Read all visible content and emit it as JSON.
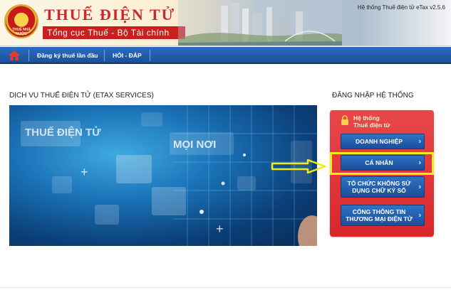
{
  "header": {
    "emblem_text": "THUẾ NHÀ NƯỚC",
    "title": "THUẾ ĐIỆN TỬ",
    "subtitle": "Tổng cục Thuế - Bộ Tài chính",
    "system_version": "Hệ thống Thuế điện tử eTax v2.5.6"
  },
  "nav": {
    "home_icon": "home-icon",
    "items": [
      {
        "label": "Đăng ký thuế lần đầu"
      },
      {
        "label": "HỎI - ĐÁP"
      }
    ]
  },
  "main": {
    "section_title": "DỊCH VỤ THUẾ ĐIỆN TỬ (ETAX SERVICES)",
    "banner_text_1": "THUẾ ĐIỆN TỬ",
    "banner_text_2": "MỌI NƠI"
  },
  "login": {
    "section_title": "ĐĂNG NHẬP HỆ THỐNG",
    "panel_label_line1": "Hệ thống",
    "panel_label_line2": "Thuế điện tử",
    "buttons": [
      {
        "label": "DOANH NGHIỆP"
      },
      {
        "label": "CÁ NHÂN"
      },
      {
        "label_line1": "TỔ CHỨC KHÔNG SỬ",
        "label_line2": "DỤNG CHỮ KÝ SỐ"
      },
      {
        "label_line1": "CỔNG THÔNG TIN",
        "label_line2": "THƯƠNG MẠI ĐIỆN TỬ"
      }
    ],
    "chevron_icon": "chevron-right-icon"
  },
  "colors": {
    "brand_red": "#c8201f",
    "nav_blue": "#1b4f9a",
    "button_blue": "#1a4e9b",
    "panel_red": "#d9262a",
    "highlight_yellow": "#f2ea16"
  }
}
